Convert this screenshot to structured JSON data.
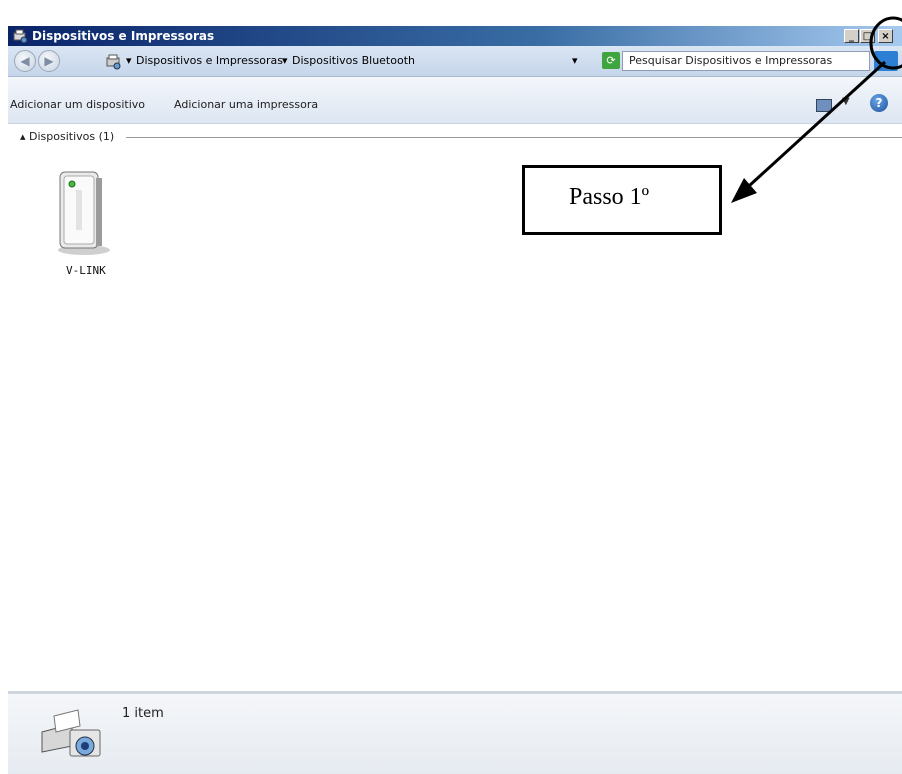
{
  "window": {
    "title": "Dispositivos e Impressoras",
    "minimize_label": "_",
    "maximize_label": "□",
    "close_label": "×"
  },
  "address": {
    "crumb_1": "Dispositivos e Impressoras",
    "crumb_2": "Dispositivos Bluetooth",
    "separator": "▾",
    "search_placeholder": "Pesquisar Dispositivos e Impressoras"
  },
  "toolbar": {
    "add_device_label": "Adicionar um dispositivo",
    "add_printer_label": "Adicionar uma impressora",
    "help_label": "?"
  },
  "content": {
    "group_header": "Dispositivos (1)",
    "devices": [
      {
        "label": "V-LINK"
      }
    ]
  },
  "status": {
    "count_text": "1 item"
  },
  "annotation": {
    "callout_text": "Passo 1º",
    "color": "#000000"
  },
  "colors": {
    "title_bar": "#0a246a",
    "refresh": "#3fa53f"
  }
}
